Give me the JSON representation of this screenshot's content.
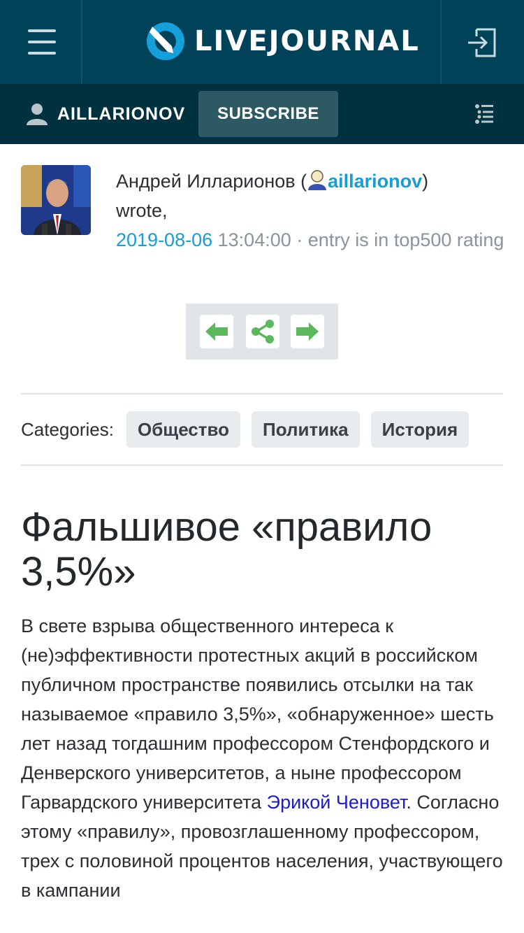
{
  "header": {
    "brand": "LIVEJOURNAL",
    "menu_icon": "hamburger-menu-icon",
    "login_icon": "login-icon"
  },
  "subheader": {
    "username": "AILLARIONOV",
    "subscribe_label": "SUBSCRIBE",
    "toc_icon": "list-icon"
  },
  "entry": {
    "author_name": "Андрей Илларионов (",
    "author_user": "aillarionov",
    "author_close": ")",
    "wrote": "wrote,",
    "date": "2019-08-06",
    "time": "13:04:00",
    "separator": "·",
    "rating_text": "entry is in top500 rating"
  },
  "nav": {
    "prev_icon": "arrow-left-icon",
    "share_icon": "share-icon",
    "next_icon": "arrow-right-icon"
  },
  "categories": {
    "label": "Categories:",
    "items": [
      "Общество",
      "Политика",
      "История"
    ]
  },
  "post": {
    "title": "Фальшивое «правило 3,5%»",
    "body_before_link": "В свете взрыва общественного интереса к (не)эффективности протестных акций в российском публичном пространстве появились отсылки на так называемое «правило 3,5%», «обнаруженное» шесть лет назад тогдашним профессором Стенфордского и Денверского университетов, а ныне профессором Гарвардского университета ",
    "body_link": "Эрикой Ченовет",
    "body_after_link": ". Согласно этому «правилу», провозглашенному профессором, трех с половиной процентов населения, участвующего в кампании"
  },
  "colors": {
    "topbar": "#004359",
    "subbar": "#00313f",
    "accent": "#169dd4",
    "nav_arrow": "#5cb85c"
  }
}
